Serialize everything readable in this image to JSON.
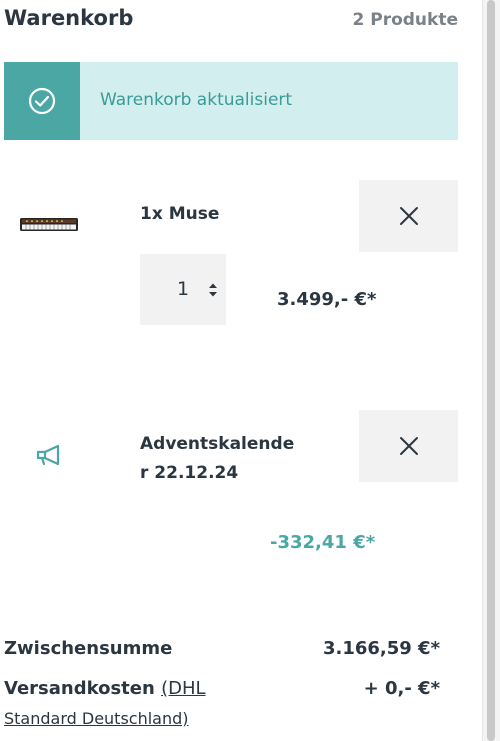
{
  "header": {
    "title": "Warenkorb",
    "count": "2 Produkte"
  },
  "alert": {
    "message": "Warenkorb aktualisiert",
    "icon": "check-circle-icon",
    "accent": "#4aa7a3",
    "background": "#d3eeee"
  },
  "items": [
    {
      "name": "1x Muse",
      "quantity": "1",
      "price": "3.499,- €*",
      "thumbnail": "synthesizer-thumbnail"
    },
    {
      "name": "Adventskalender 22.12.24",
      "price": "-332,41 €*",
      "icon": "megaphone-icon"
    }
  ],
  "summary": {
    "subtotal_label": "Zwischensumme",
    "subtotal_value": "3.166,59 €*",
    "shipping_label": "Versandkosten",
    "shipping_method": "(DHL Standard Deutschland)",
    "shipping_value": "+ 0,- €*"
  }
}
